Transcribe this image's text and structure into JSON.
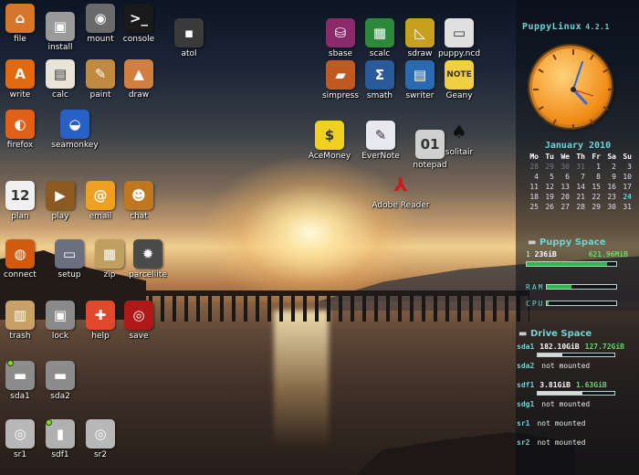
{
  "desktop": {
    "icons_left": [
      {
        "label": "file",
        "glyph": "⌂",
        "bg": "#d4762c",
        "icon": "home-icon"
      },
      {
        "label": "install",
        "glyph": "▣",
        "bg": "#9a9a9a",
        "icon": "package-icon"
      },
      {
        "label": "mount",
        "glyph": "◉",
        "bg": "#6a6a6a",
        "icon": "harddisk-icon"
      },
      {
        "label": "console",
        "glyph": ">_",
        "bg": "#1a1a1a",
        "icon": "terminal-icon"
      },
      {
        "label": "write",
        "glyph": "A",
        "bg": "#e06a10",
        "icon": "writer-icon"
      },
      {
        "label": "calc",
        "glyph": "▤",
        "bg": "#e8e4d8",
        "icon": "calculator-icon"
      },
      {
        "label": "paint",
        "glyph": "✎",
        "bg": "#c08a40",
        "icon": "palette-icon"
      },
      {
        "label": "draw",
        "glyph": "▲",
        "bg": "#d08040",
        "icon": "shapes-icon"
      },
      {
        "label": "firefox",
        "glyph": "◐",
        "bg": "#e0601a",
        "icon": "firefox-icon"
      },
      {
        "label": "seamonkey",
        "glyph": "◒",
        "bg": "#2860c8",
        "icon": "seamonkey-icon"
      },
      {
        "label": "plan",
        "glyph": "12",
        "bg": "#f0f0f0",
        "icon": "calendar-icon"
      },
      {
        "label": "play",
        "glyph": "▶",
        "bg": "#8a5a20",
        "icon": "film-icon"
      },
      {
        "label": "email",
        "glyph": "@",
        "bg": "#f0a020",
        "icon": "email-icon"
      },
      {
        "label": "chat",
        "glyph": "☻",
        "bg": "#c07820",
        "icon": "chat-icon"
      },
      {
        "label": "connect",
        "glyph": "◍",
        "bg": "#d05a10",
        "icon": "globe-icon"
      },
      {
        "label": "setup",
        "glyph": "▭",
        "bg": "#6a7080",
        "icon": "monitor-icon"
      },
      {
        "label": "zip",
        "glyph": "▦",
        "bg": "#c0a060",
        "icon": "archive-icon"
      },
      {
        "label": "parcellite",
        "glyph": "✹",
        "bg": "#4a4a4a",
        "icon": "gear-icon"
      },
      {
        "label": "trash",
        "glyph": "▥",
        "bg": "#c8a068",
        "icon": "trash-icon"
      },
      {
        "label": "lock",
        "glyph": "▣",
        "bg": "#8a8a8a",
        "icon": "lock-icon"
      },
      {
        "label": "help",
        "glyph": "✚",
        "bg": "#e04a2a",
        "icon": "lifebuoy-icon"
      },
      {
        "label": "save",
        "glyph": "◎",
        "bg": "#b01818",
        "icon": "save-icon"
      },
      {
        "label": "sda1",
        "glyph": "▬",
        "bg": "#8c8c8c",
        "icon": "drive-icon"
      },
      {
        "label": "sda2",
        "glyph": "▬",
        "bg": "#8c8c8c",
        "icon": "drive-icon"
      },
      {
        "label": "sr1",
        "glyph": "◎",
        "bg": "#b8b8b8",
        "icon": "cdrom-icon"
      },
      {
        "label": "sdf1",
        "glyph": "▮",
        "bg": "#b0b0b0",
        "icon": "usb-icon"
      },
      {
        "label": "sr2",
        "glyph": "◎",
        "bg": "#b8b8b8",
        "icon": "cdrom-icon"
      }
    ],
    "icons_right": [
      {
        "label": "atol",
        "glyph": "▪",
        "bg": "#3a3a3a",
        "icon": "atol-icon"
      },
      {
        "label": "sbase",
        "glyph": "⛁",
        "bg": "#8a2a6a",
        "icon": "database-icon"
      },
      {
        "label": "scalc",
        "glyph": "▦",
        "bg": "#2a8a3a",
        "icon": "spreadsheet-icon"
      },
      {
        "label": "sdraw",
        "glyph": "◺",
        "bg": "#c8a020",
        "icon": "draw-icon"
      },
      {
        "label": "puppy.ncd",
        "glyph": "▭",
        "bg": "#e0e0e0",
        "icon": "document-icon"
      },
      {
        "label": "simpress",
        "glyph": "▰",
        "bg": "#c05a20",
        "icon": "presentation-icon"
      },
      {
        "label": "smath",
        "glyph": "Σ",
        "bg": "#2a5a9a",
        "icon": "math-icon"
      },
      {
        "label": "swriter",
        "glyph": "▤",
        "bg": "#2a6ab0",
        "icon": "writer-doc-icon"
      },
      {
        "label": "Geany",
        "glyph": "NOTE",
        "bg": "#f0d040",
        "icon": "geany-icon"
      },
      {
        "label": "AceMoney",
        "glyph": "$",
        "bg": "#f0d020",
        "icon": "money-icon"
      },
      {
        "label": "EverNote",
        "glyph": "✎",
        "bg": "#e8e8f0",
        "icon": "evernote-icon"
      },
      {
        "label": "notepad",
        "glyph": "01",
        "bg": "#d0d0d0",
        "icon": "notepad-icon"
      },
      {
        "label": "solitair",
        "glyph": "♠",
        "bg": "transparent",
        "icon": "spade-icon"
      },
      {
        "label": "Adobe Reader",
        "glyph": "⅄",
        "bg": "transparent",
        "icon": "adobe-reader-icon"
      }
    ]
  },
  "panel": {
    "brand": "PuppyLinux",
    "version": "4.2.1",
    "calendar": {
      "month": "January 2010",
      "headers": [
        "Mo",
        "Tu",
        "We",
        "Th",
        "Fr",
        "Sa",
        "Su"
      ],
      "days": [
        "28",
        "29",
        "30",
        "31",
        "1",
        "2",
        "3",
        "4",
        "5",
        "6",
        "7",
        "8",
        "9",
        "10",
        "11",
        "12",
        "13",
        "14",
        "15",
        "16",
        "17",
        "18",
        "19",
        "20",
        "21",
        "22",
        "23",
        "24",
        "25",
        "26",
        "27",
        "28",
        "29",
        "30",
        "31"
      ],
      "today": "24"
    },
    "puppy_space": {
      "title": "Puppy Space",
      "index": "1",
      "total": "236iB",
      "free": "621.96MiB",
      "usage": 0.9
    },
    "ram_label": "RAM",
    "ram_usage": 0.35,
    "cpu_label": "CPU",
    "cpu_usage": 0.03,
    "drive_space": {
      "title": "Drive Space",
      "drives": [
        {
          "name": "sda1",
          "total": "182.10GiB",
          "free": "127.72GiB",
          "mounted": true,
          "usage": 0.32
        },
        {
          "name": "sda2",
          "status": "not mounted",
          "mounted": false
        },
        {
          "name": "sdf1",
          "total": "3.81GiB",
          "free": "1.63GiB",
          "mounted": true,
          "usage": 0.58
        },
        {
          "name": "sdg1",
          "status": "not mounted",
          "mounted": false
        },
        {
          "name": "sr1",
          "status": "not mounted",
          "mounted": false
        },
        {
          "name": "sr2",
          "status": "not mounted",
          "mounted": false
        }
      ]
    },
    "colors": {
      "accent": "#6fd3d3",
      "bar": "#2db84a",
      "free": "#67d86b"
    }
  }
}
